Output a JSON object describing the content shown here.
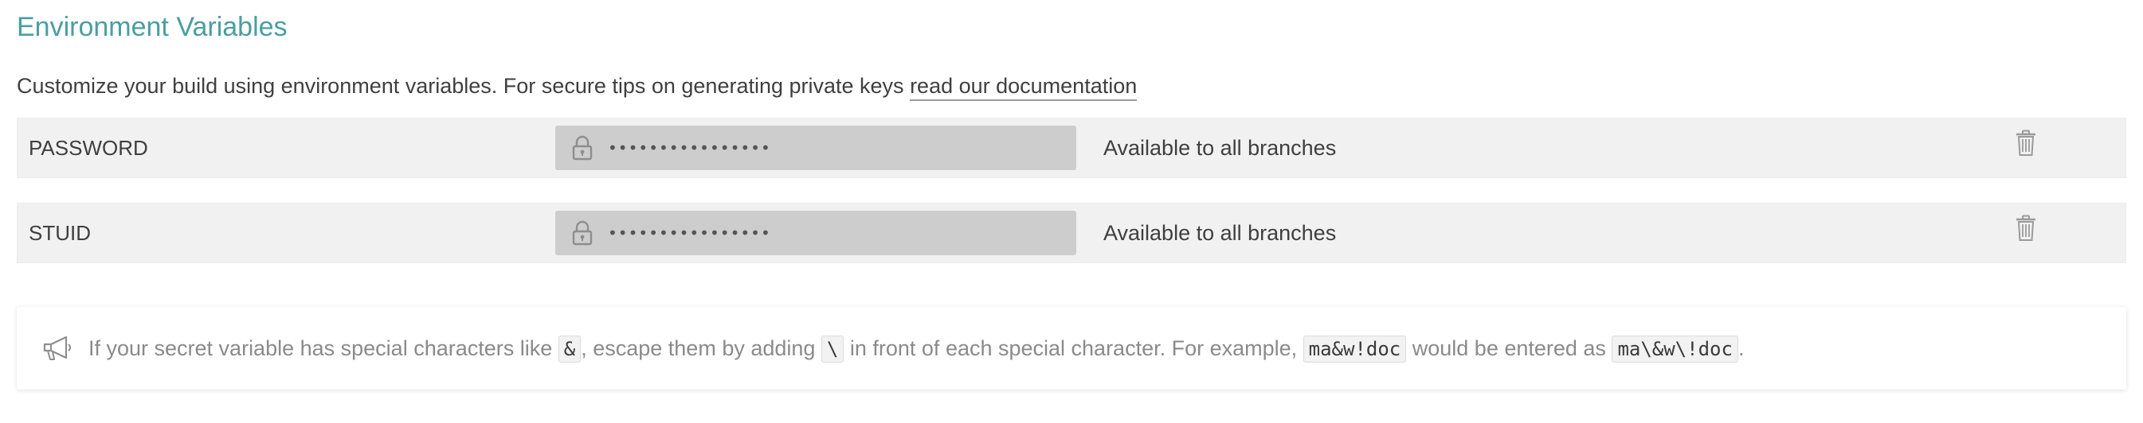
{
  "header": {
    "title": "Environment Variables",
    "description": "Customize your build using environment variables. For secure tips on generating private keys ",
    "doc_link": "read our documentation"
  },
  "variables": [
    {
      "name": "PASSWORD",
      "value_mask": "••••••••••••••••",
      "scope": "Available to all branches"
    },
    {
      "name": "STUID",
      "value_mask": "••••••••••••••••",
      "scope": "Available to all branches"
    }
  ],
  "notice": {
    "part1": "If your secret variable has special characters like ",
    "code1": "&",
    "part2": ", escape them by adding ",
    "code2": "\\",
    "part3": " in front of each special character. For example, ",
    "code3": "ma&w!doc",
    "part4": " would be entered as ",
    "code4": "ma\\&w\\!doc",
    "part5": "."
  },
  "icons": {
    "lock": "lock-icon",
    "trash": "trash-icon",
    "megaphone": "megaphone-icon"
  },
  "colors": {
    "title": "#4a9ea1",
    "row_bg": "#f1f1f1",
    "input_bg": "#cdcdcd",
    "notice_text": "#8a8a8a"
  }
}
